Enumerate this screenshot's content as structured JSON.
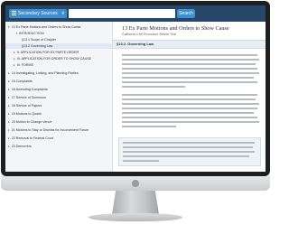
{
  "toolbar": {
    "source_label": "Secondary Sources",
    "search_button": "Search"
  },
  "toc": [
    {
      "label": "13 Ex Parte Motions and Orders to Show Cause",
      "arrow": "▾"
    },
    {
      "label": "I. INTRODUCTION",
      "arrow": ""
    },
    {
      "label": "§13.1 Scope of Chapter",
      "arrow": ""
    },
    {
      "label": "§13.2 Governing Law",
      "arrow": ""
    },
    {
      "label": "II. APPLICATION FOR EX PARTE ORDER",
      "arrow": "▸"
    },
    {
      "label": "III. APPLICATION FOR ORDER TO SHOW CAUSE",
      "arrow": "▸"
    },
    {
      "label": "IV. FORMS",
      "arrow": "▸"
    },
    {
      "label": "14 Investigating, Linking, and Planning Parties",
      "arrow": "▸"
    },
    {
      "label": "15 Complaints",
      "arrow": "▸"
    },
    {
      "label": "16 Amending Complaints",
      "arrow": "▸"
    },
    {
      "label": "17 Service of Summons",
      "arrow": "▸"
    },
    {
      "label": "18 Service of Papers",
      "arrow": "▸"
    },
    {
      "label": "19 Motions to Quash",
      "arrow": "▸"
    },
    {
      "label": "20 Motion to Change Venue",
      "arrow": "▸"
    },
    {
      "label": "21 Motions to Stay or Dismiss for Inconvenient Forum",
      "arrow": "▸"
    },
    {
      "label": "22 Removal to Federal Court",
      "arrow": "▸"
    },
    {
      "label": "23 Demurrers",
      "arrow": "▸"
    }
  ],
  "document": {
    "title": "13 Ex Parte Motions and Orders to Show Cause",
    "subtitle": "California Civil Procedure Before Trial",
    "section_label": "§13.2. Governing Law"
  }
}
